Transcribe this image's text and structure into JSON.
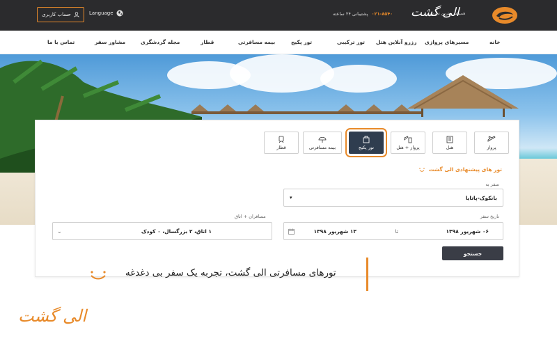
{
  "header": {
    "account_label": "حساب کاربری",
    "language_label": "Language",
    "support_label": "پشتیبانی ۲۴ ساعته",
    "support_phone": "۰۲۱-۸۵۴۰",
    "logo_text": "الی گشت",
    "logo_tagline": "همیشه بهترین تجربه"
  },
  "nav": {
    "items": [
      {
        "label": "خانه"
      },
      {
        "label": "مسیرهای پروازی"
      },
      {
        "label": "رزرو آنلاین هتل"
      },
      {
        "label": "تور ترکیبی"
      },
      {
        "label": "تور پکیج"
      },
      {
        "label": "بیمه مسافرتی"
      },
      {
        "label": "قطار"
      },
      {
        "label": "مجله گردشگری"
      },
      {
        "label": "مشاور سفر"
      },
      {
        "label": "تماس با ما"
      }
    ]
  },
  "search": {
    "tabs": [
      {
        "label": "پرواز",
        "icon": "plane-icon"
      },
      {
        "label": "هتل",
        "icon": "hotel-icon"
      },
      {
        "label": "پرواز + هتل",
        "icon": "plane-hotel-icon"
      },
      {
        "label": "تور پکیج",
        "icon": "package-icon",
        "active": true
      },
      {
        "label": "بیمه مسافرتی",
        "icon": "umbrella-icon"
      },
      {
        "label": "قطار",
        "icon": "train-icon"
      }
    ],
    "suggest_title": "تور های پیشنهادی الی گشت",
    "destination_label": "سفر به",
    "destination_value": "بانکوک-پاتایا",
    "date_label": "تاریخ سفر",
    "date_from": "۰۶ شهریور ۱۳۹۸",
    "date_to_word": "تا",
    "date_to": "۱۳ شهریور ۱۳۹۸",
    "passengers_label": "مسافران + اتاق",
    "passengers_value": "۱ اتاق، ۲ بزرگسال، ۰ کودک",
    "submit_label": "جستجو"
  },
  "caption": {
    "text": "تورهای مسافرتی الی گشت، تجربه یک سفر بی دغدغه",
    "bottom_logo": "الی گشت"
  },
  "colors": {
    "accent": "#e88a2a",
    "header_bg": "#2b2b2d",
    "active_tab": "#2f3d4f"
  }
}
